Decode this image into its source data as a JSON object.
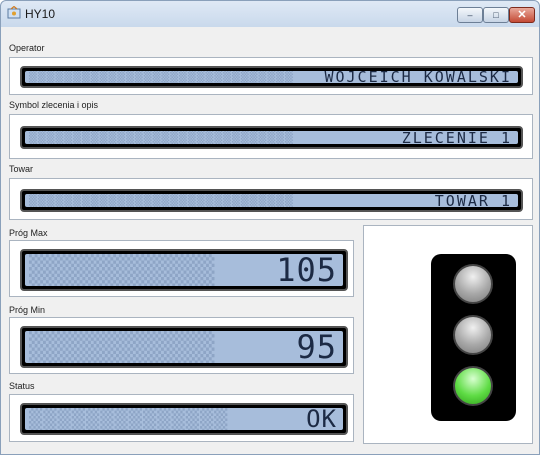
{
  "window": {
    "title": "HY10",
    "min_glyph": "–",
    "max_glyph": "□",
    "close_glyph": "✕"
  },
  "operator": {
    "label": "Operator",
    "value": "WOJCEICH KOWALSKI",
    "ghost": "▒▒▒▒▒▒▒▒▒▒▒▒▒▒▒▒▒▒▒▒▒▒▒▒▒▒▒▒▒▒"
  },
  "order": {
    "label": "Symbol zlecenia i opis",
    "value": "ZLECENIE 1",
    "ghost": "▒▒▒▒▒▒▒▒▒▒▒▒▒▒▒▒▒▒▒▒▒▒▒▒▒▒▒▒▒▒"
  },
  "product": {
    "label": "Towar",
    "value": "TOWAR 1",
    "ghost": "▒▒▒▒▒▒▒▒▒▒▒▒▒▒▒▒▒▒▒▒▒▒▒▒▒▒▒▒▒▒"
  },
  "threshold_max": {
    "label": "Próg Max",
    "value": "105",
    "ghost": "▒▒▒▒▒▒▒▒▒▒▒"
  },
  "threshold_min": {
    "label": "Próg Min",
    "value": "95",
    "ghost": "▒▒▒▒▒▒▒▒▒▒▒"
  },
  "status": {
    "label": "Status",
    "value": "OK",
    "ghost": "▒▒▒▒▒▒▒▒▒▒▒▒▒▒"
  },
  "traffic_light": {
    "top": "off",
    "middle": "off",
    "bottom": "on",
    "on_color": "#5fdc45"
  }
}
